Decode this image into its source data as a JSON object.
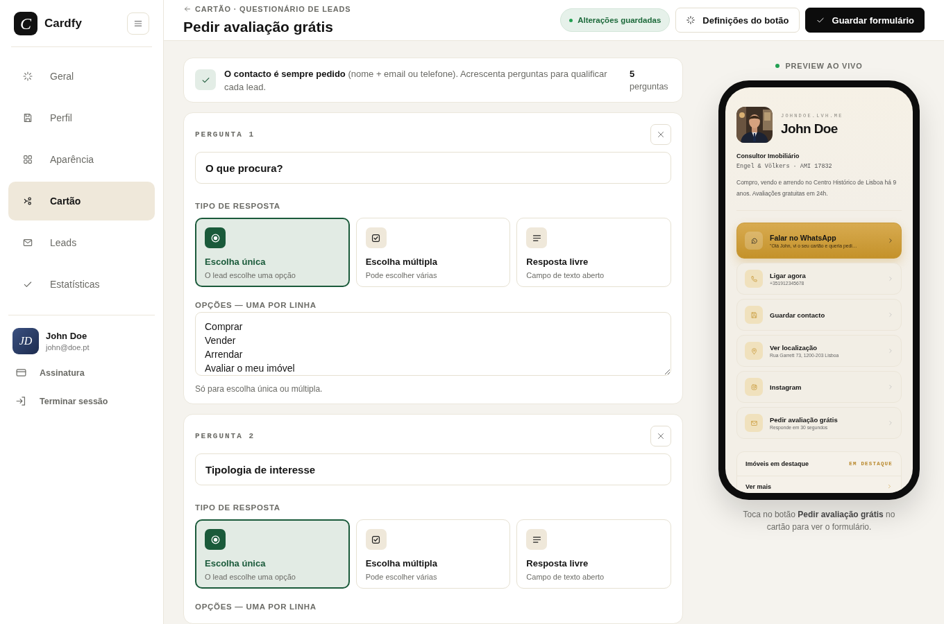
{
  "sidebar": {
    "brand": {
      "logo_letter": "C",
      "name": "Cardfy"
    },
    "nav": [
      {
        "label": "Geral",
        "selected": false
      },
      {
        "label": "Perfil",
        "selected": false
      },
      {
        "label": "Aparência",
        "selected": false
      },
      {
        "label": "Cartão",
        "selected": true
      },
      {
        "label": "Leads",
        "selected": false
      },
      {
        "label": "Estatísticas",
        "selected": false
      }
    ],
    "user": {
      "initials": "JD",
      "name": "John Doe",
      "email": "john@doe.pt"
    },
    "links": [
      {
        "label": "Assinatura"
      },
      {
        "label": "Terminar sessão"
      }
    ]
  },
  "header": {
    "breadcrumb": "CARTÃO · QUESTIONÁRIO DE LEADS",
    "title": "Pedir avaliação grátis",
    "status": "Alterações guardadas",
    "buttons": [
      {
        "label": "Definições do botão",
        "kind": "secondary"
      },
      {
        "label": "Guardar formulário",
        "kind": "primary"
      }
    ]
  },
  "info": {
    "text": "**O contacto é sempre pedido** (nome + email ou telefone). Acrescenta perguntas para qualificar cada lead.",
    "count": "5",
    "count_label": "perguntas"
  },
  "questions": [
    {
      "label": "PERGUNTA 1",
      "question": "O que procura?",
      "type_label": "TIPO DE RESPOSTA",
      "answer_types": [
        {
          "kind": "single",
          "title": "Escolha única",
          "subtitle": "O lead escolhe uma opção",
          "selected": true
        },
        {
          "kind": "multiple",
          "title": "Escolha múltipla",
          "subtitle": "Pode escolher várias",
          "selected": false
        },
        {
          "kind": "free",
          "title": "Resposta livre",
          "subtitle": "Campo de texto aberto",
          "selected": false
        }
      ],
      "options_label": "OPÇÕES — UMA POR LINHA",
      "options": [
        "Comprar",
        "Vender",
        "Arrendar",
        "Avaliar o meu imóvel"
      ],
      "hint": "Só para escolha única ou múltipla."
    },
    {
      "label": "PERGUNTA 2",
      "question": "Tipologia de interesse",
      "type_label": "TIPO DE RESPOSTA",
      "answer_types": [
        {
          "kind": "single",
          "title": "Escolha única",
          "subtitle": "O lead escolhe uma opção",
          "selected": true
        },
        {
          "kind": "multiple",
          "title": "Escolha múltipla",
          "subtitle": "Pode escolher várias",
          "selected": false
        },
        {
          "kind": "free",
          "title": "Resposta livre",
          "subtitle": "Campo de texto aberto",
          "selected": false
        }
      ],
      "options_label": "OPÇÕES — UMA POR LINHA"
    }
  ],
  "preview": {
    "label": "PREVIEW AO VIVO",
    "card": {
      "domain": "JOHNDOE.LVH.ME",
      "name": "John Doe",
      "role": "Consultor Imobiliário",
      "company": "Engel & Völkers · AMI 17832",
      "bio": "Compro, vendo e arrendo no Centro Histórico de Lisboa há 9 anos. Avaliações gratuitas em 24h.",
      "actions": [
        {
          "title": "Falar no WhatsApp",
          "subtitle": "\"Olá John, vi o seu cartão e queria pedi…",
          "highlighted": true
        },
        {
          "title": "Ligar agora",
          "subtitle": "+351912345678",
          "highlighted": false
        },
        {
          "title": "Guardar contacto",
          "highlighted": false
        },
        {
          "title": "Ver localização",
          "subtitle": "Rua Garrett 73, 1200-203 Lisboa",
          "highlighted": false
        },
        {
          "title": "Instagram",
          "highlighted": false
        },
        {
          "title": "Pedir avaliação grátis",
          "subtitle": "Responde em 30 segundos",
          "highlighted": false
        }
      ],
      "featured": {
        "title": "Imóveis em destaque",
        "tag": "EM DESTAQUE",
        "link": "Ver mais"
      }
    },
    "caption": "Toca no botão **Pedir avaliação grátis** no cartão para ver o formulário."
  }
}
